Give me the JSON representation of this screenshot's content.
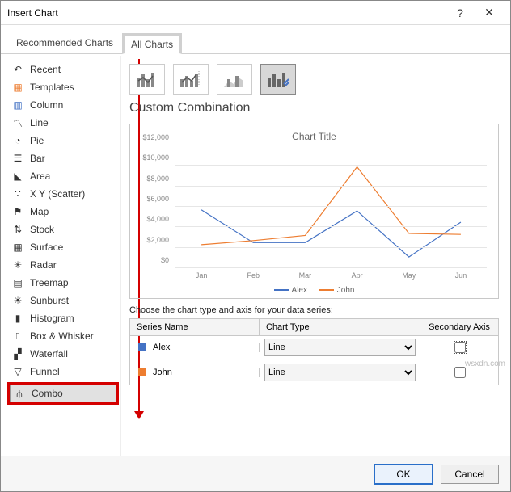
{
  "title": "Insert Chart",
  "tabs": {
    "recommended": "Recommended Charts",
    "all": "All Charts"
  },
  "sidebar": {
    "items": [
      {
        "label": "Recent"
      },
      {
        "label": "Templates"
      },
      {
        "label": "Column"
      },
      {
        "label": "Line"
      },
      {
        "label": "Pie"
      },
      {
        "label": "Bar"
      },
      {
        "label": "Area"
      },
      {
        "label": "X Y (Scatter)"
      },
      {
        "label": "Map"
      },
      {
        "label": "Stock"
      },
      {
        "label": "Surface"
      },
      {
        "label": "Radar"
      },
      {
        "label": "Treemap"
      },
      {
        "label": "Sunburst"
      },
      {
        "label": "Histogram"
      },
      {
        "label": "Box & Whisker"
      },
      {
        "label": "Waterfall"
      },
      {
        "label": "Funnel"
      },
      {
        "label": "Combo"
      }
    ]
  },
  "content": {
    "subtitle": "Custom Combination",
    "chart_title": "Chart Title",
    "series_prompt": "Choose the chart type and axis for your data series:",
    "head": {
      "name": "Series Name",
      "type": "Chart Type",
      "sec": "Secondary Axis"
    },
    "series": [
      {
        "name": "Alex",
        "color": "#4472c4",
        "type": "Line",
        "secondary": false,
        "focus": true
      },
      {
        "name": "John",
        "color": "#ed7d31",
        "type": "Line",
        "secondary": false,
        "focus": false
      }
    ],
    "legend": {
      "alex": "Alex",
      "john": "John"
    }
  },
  "footer": {
    "ok": "OK",
    "cancel": "Cancel"
  },
  "watermark": "wsxdn.com",
  "chart_data": {
    "type": "line",
    "title": "Chart Title",
    "xlabel": "",
    "ylabel": "",
    "ylim": [
      0,
      12000
    ],
    "y_ticks": [
      "$0",
      "$2,000",
      "$4,000",
      "$6,000",
      "$8,000",
      "$10,000",
      "$12,000"
    ],
    "categories": [
      "Jan",
      "Feb",
      "Mar",
      "Apr",
      "May",
      "Jun"
    ],
    "series": [
      {
        "name": "Alex",
        "color": "#4472c4",
        "values": [
          5700,
          2500,
          2500,
          5600,
          1100,
          4500
        ]
      },
      {
        "name": "John",
        "color": "#ed7d31",
        "values": [
          2300,
          2700,
          3200,
          9900,
          3400,
          3300
        ]
      }
    ]
  }
}
